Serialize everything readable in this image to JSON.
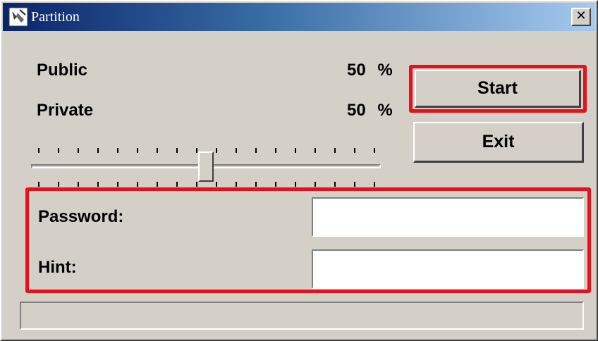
{
  "window": {
    "title": "Partition",
    "close_label": "✕"
  },
  "allocation": {
    "public_label": "Public",
    "public_value": "50",
    "private_label": "Private",
    "private_value": "50",
    "percent_sign": "%",
    "slider_value_percent": 50
  },
  "buttons": {
    "start_label": "Start",
    "exit_label": "Exit"
  },
  "credentials": {
    "password_label": "Password:",
    "password_value": "",
    "hint_label": "Hint:",
    "hint_value": ""
  },
  "status": {
    "progress_percent": 0
  },
  "colors": {
    "highlight": "#e8101a",
    "window_bg": "#d4d0c8",
    "title_gradient_start": "#0a246a",
    "title_gradient_end": "#a6caf0"
  },
  "icons": {
    "title_icon": "disk-partition-icon",
    "close_icon": "close-icon"
  }
}
